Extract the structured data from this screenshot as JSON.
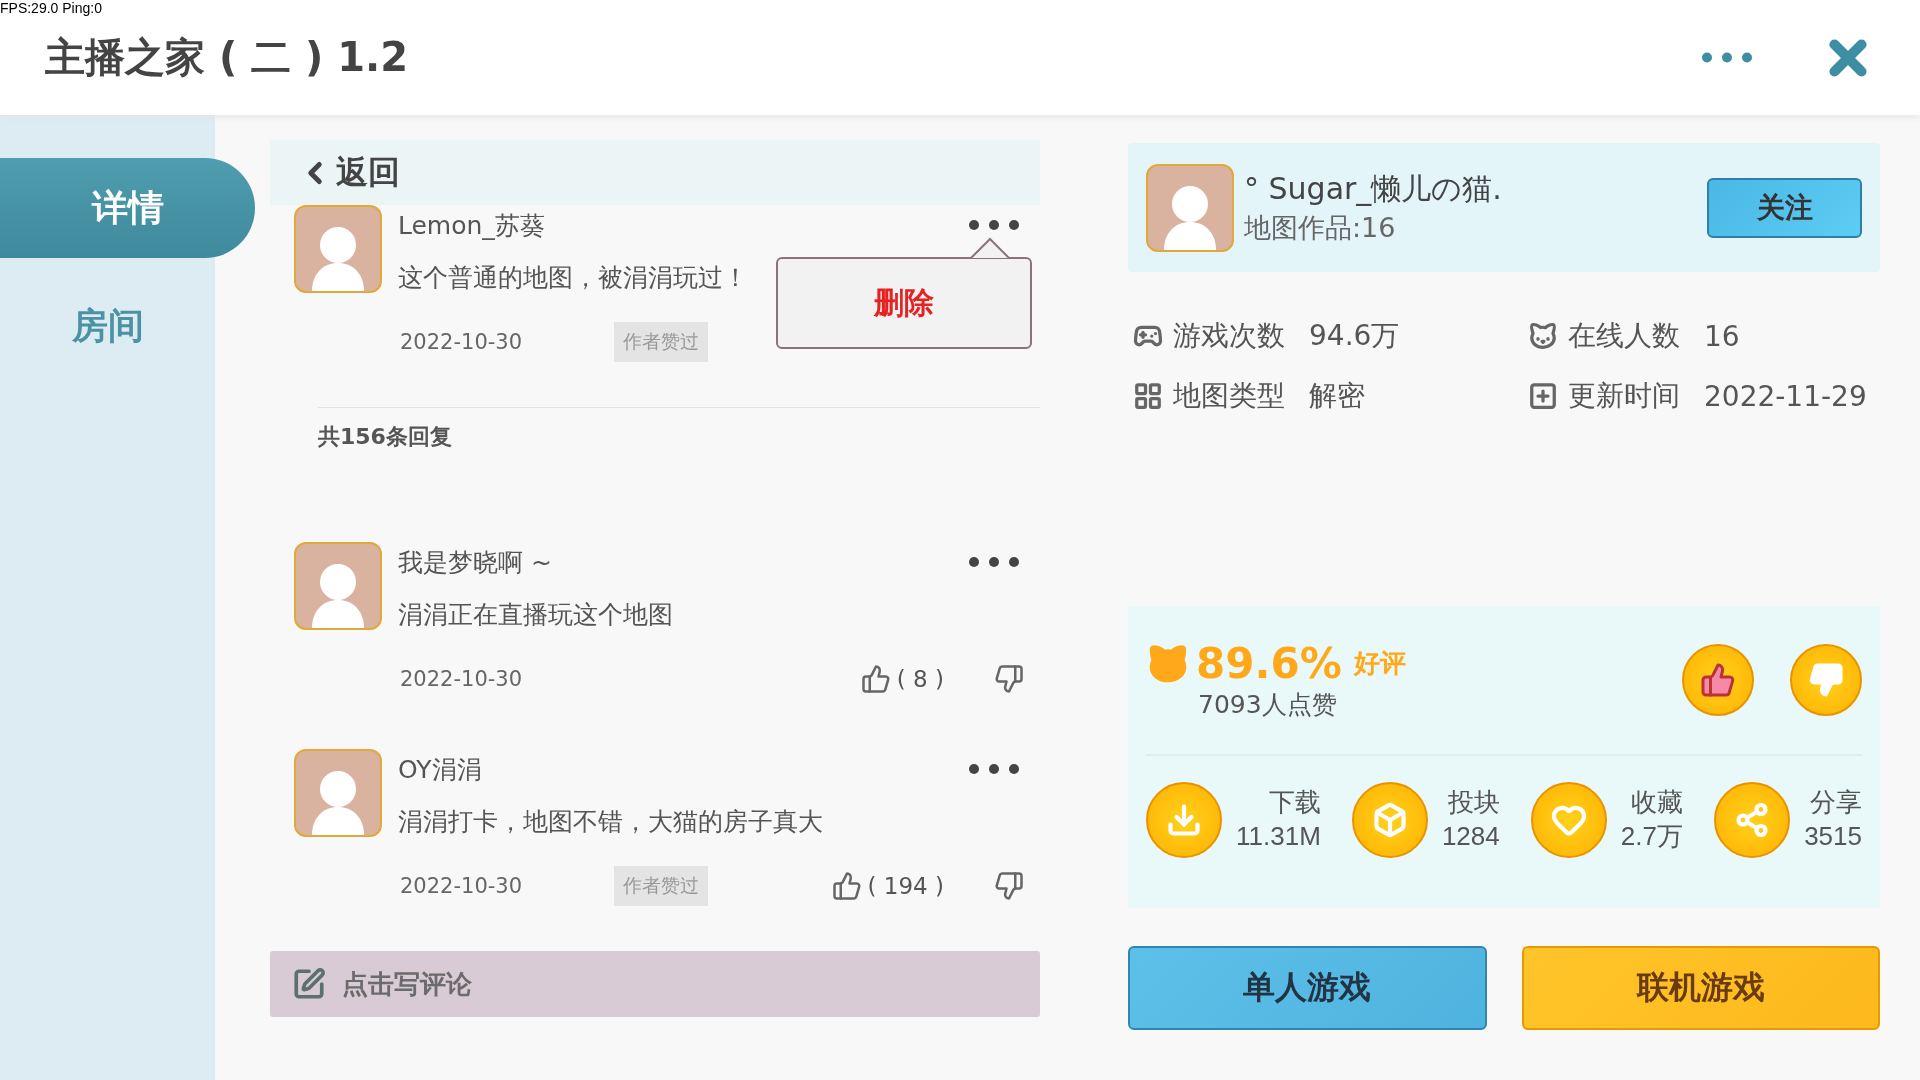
{
  "debug_overlay": "FPS:29.0  Ping:0",
  "window": {
    "title": "主播之家 ( 二 ) 1.2"
  },
  "sidebar": {
    "items": [
      {
        "label": "详情",
        "selected": true
      },
      {
        "label": "房间",
        "selected": false
      }
    ]
  },
  "back_button": {
    "label": "返回"
  },
  "comment": {
    "author": "Lemon_苏葵",
    "text": "这个普通的地图，被涓涓玩过！",
    "date": "2022-10-30",
    "author_liked": true,
    "author_liked_label": "作者赞过",
    "menu_open": true,
    "menu_items": [
      "删除"
    ]
  },
  "replies": {
    "count": "共156条回复",
    "items": [
      {
        "author": "我是梦晓啊 ~",
        "text": "涓涓正在直播玩这个地图",
        "date": "2022-10-30",
        "author_liked": false,
        "likes": "( 8 )",
        "menu_open": false
      },
      {
        "author": "OY涓涓",
        "text": "涓涓打卡，地图不错，大猫的房子真大",
        "date": "2022-10-30",
        "author_liked": true,
        "author_liked_label": "作者赞过",
        "likes": "( 194 )",
        "menu_open": false
      }
    ]
  },
  "write_comment": {
    "placeholder": "点击写评论"
  },
  "creator": {
    "name": "°  Sugar_懒儿の猫.",
    "works": "地图作品:16",
    "follow_label": "关注"
  },
  "info": [
    {
      "kind": "plays",
      "label": "游戏次数",
      "value": "94.6万"
    },
    {
      "kind": "online",
      "label": "在线人数",
      "value": "16"
    },
    {
      "kind": "type",
      "label": "地图类型",
      "value": "解密"
    },
    {
      "kind": "updated",
      "label": "更新时间",
      "value": "2022-11-29"
    }
  ],
  "rating": {
    "percent": "89.6%",
    "suffix": "好评",
    "likes": "7093人点赞"
  },
  "actions": [
    {
      "kind": "download",
      "label": "下载",
      "value": "11.31M"
    },
    {
      "kind": "block",
      "label": "投块",
      "value": "1284"
    },
    {
      "kind": "favorite",
      "label": "收藏",
      "value": "2.7万"
    },
    {
      "kind": "share",
      "label": "分享",
      "value": "3515"
    }
  ],
  "play_buttons": [
    {
      "kind": "single",
      "label": "单人游戏"
    },
    {
      "kind": "multi",
      "label": "联机游戏"
    }
  ]
}
